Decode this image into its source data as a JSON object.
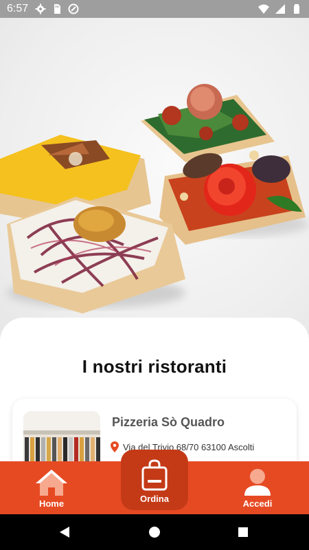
{
  "status_bar": {
    "time": "6:57",
    "left_icons": [
      "gear-icon",
      "sd-card-icon",
      "no-disturb-icon"
    ],
    "right_icons": [
      "wifi-icon",
      "signal-icon",
      "battery-icon"
    ]
  },
  "main": {
    "section_title": "I nostri ristoranti",
    "restaurants": [
      {
        "name": "Pizzeria Sò Quadro",
        "address": "Via del Trivio 68/70 63100 Ascolti"
      }
    ]
  },
  "bottom_nav": {
    "items": [
      {
        "label": "Home",
        "icon": "home-icon"
      },
      {
        "label": "Ordina",
        "icon": "shopping-bag-icon"
      },
      {
        "label": "Accedi",
        "icon": "user-icon"
      }
    ],
    "colors": {
      "bar": "#e64a23",
      "active": "#c43a17"
    }
  },
  "android_nav": {
    "buttons": [
      "back-icon",
      "home-circle-icon",
      "recents-icon"
    ]
  }
}
